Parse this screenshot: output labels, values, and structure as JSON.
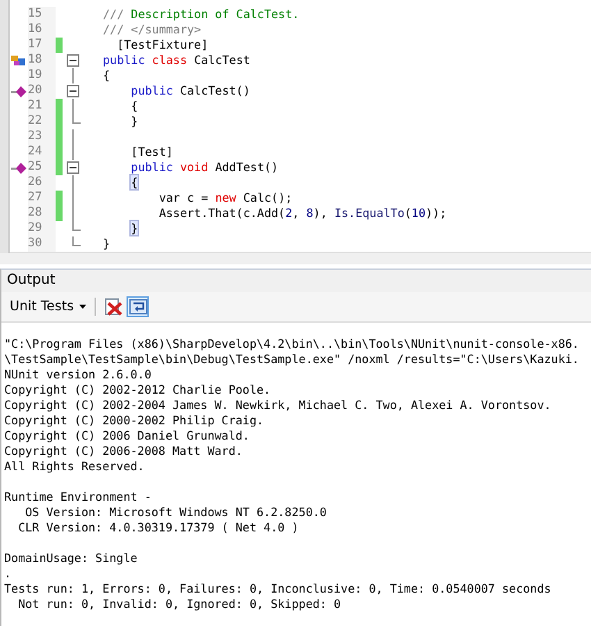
{
  "editor": {
    "lines": [
      {
        "number": "15",
        "changed": false,
        "kind": "plain",
        "tokens": [
          {
            "kind": "doc",
            "text": "/// "
          },
          {
            "kind": "comment",
            "text": "Description of CalcTest."
          }
        ]
      },
      {
        "number": "16",
        "changed": false,
        "kind": "plain",
        "tokens": [
          {
            "kind": "doc",
            "text": "/// </summary>"
          }
        ]
      },
      {
        "number": "17",
        "changed": true,
        "kind": "plain",
        "tokens": [
          {
            "kind": "plain",
            "text": "  [TestFixture]"
          }
        ]
      },
      {
        "number": "18",
        "changed": false,
        "kind": "class_start",
        "tokens": [
          {
            "kind": "keyword",
            "text": "public "
          },
          {
            "kind": "keyword2",
            "text": "class "
          },
          {
            "kind": "plain",
            "text": "CalcTest"
          }
        ]
      },
      {
        "number": "19",
        "changed": false,
        "kind": "body",
        "tokens": [
          {
            "kind": "plain",
            "text": "{"
          }
        ]
      },
      {
        "number": "20",
        "changed": false,
        "kind": "method_start",
        "tokens": [
          {
            "kind": "keyword",
            "text": "    public "
          },
          {
            "kind": "plain",
            "text": "CalcTest()"
          }
        ]
      },
      {
        "number": "21",
        "changed": true,
        "kind": "body",
        "tokens": [
          {
            "kind": "plain",
            "text": "    {"
          }
        ]
      },
      {
        "number": "22",
        "changed": true,
        "kind": "block_end",
        "tokens": [
          {
            "kind": "plain",
            "text": "    }"
          }
        ]
      },
      {
        "number": "23",
        "changed": true,
        "kind": "body"
      },
      {
        "number": "24",
        "changed": true,
        "kind": "body",
        "tokens": [
          {
            "kind": "plain",
            "text": "    [Test]"
          }
        ]
      },
      {
        "number": "25",
        "changed": true,
        "kind": "method_start",
        "tokens": [
          {
            "kind": "keyword",
            "text": "    public "
          },
          {
            "kind": "keyword2",
            "text": "void "
          },
          {
            "kind": "plain",
            "text": "AddTest()"
          }
        ]
      },
      {
        "number": "26",
        "changed": false,
        "kind": "body",
        "tokens": [
          {
            "kind": "brace_match",
            "text": "    {"
          }
        ]
      },
      {
        "number": "27",
        "changed": true,
        "kind": "body",
        "tokens": [
          {
            "kind": "plain",
            "text": "        var c = "
          },
          {
            "kind": "keyword2",
            "text": "new "
          },
          {
            "kind": "plain",
            "text": "Calc();"
          }
        ]
      },
      {
        "number": "28",
        "changed": true,
        "kind": "body",
        "tokens": [
          {
            "kind": "plain",
            "text": "        Assert.That(c.Add("
          },
          {
            "kind": "number",
            "text": "2"
          },
          {
            "kind": "plain",
            "text": ", "
          },
          {
            "kind": "number",
            "text": "8"
          },
          {
            "kind": "plain",
            "text": "), "
          },
          {
            "kind": "member",
            "text": "Is.EqualTo"
          },
          {
            "kind": "plain",
            "text": "("
          },
          {
            "kind": "number",
            "text": "10"
          },
          {
            "kind": "plain",
            "text": "));"
          }
        ]
      },
      {
        "number": "29",
        "changed": false,
        "kind": "block_end",
        "tokens": [
          {
            "kind": "brace_match",
            "text": "    }"
          }
        ]
      },
      {
        "number": "30",
        "changed": false,
        "kind": "block_end",
        "tokens": [
          {
            "kind": "plain",
            "text": "}"
          }
        ]
      }
    ]
  },
  "output": {
    "title": "Output",
    "dropdown": "Unit Tests",
    "buttons": [
      {
        "kind": "clear",
        "selected": false
      },
      {
        "kind": "word_wrap",
        "selected": true
      }
    ],
    "blocks": [
      [
        "\"C:\\Program Files (x86)\\SharpDevelop\\4.2\\bin\\..\\bin\\Tools\\NUnit\\nunit-console-x86.",
        "\\TestSample\\TestSample\\bin\\Debug\\TestSample.exe\" /noxml /results=\"C:\\Users\\Kazuki.",
        "NUnit version 2.6.0.0",
        "Copyright (C) 2002-2012 Charlie Poole.",
        "Copyright (C) 2002-2004 James W. Newkirk, Michael C. Two, Alexei A. Vorontsov.",
        "Copyright (C) 2000-2002 Philip Craig.",
        "Copyright (C) 2006 Daniel Grunwald.",
        "Copyright (C) 2006-2008 Matt Ward.",
        "All Rights Reserved."
      ],
      [
        "Runtime Environment -",
        "   OS Version: Microsoft Windows NT 6.2.8250.0",
        "  CLR Version: 4.0.30319.17379 ( Net 4.0 )"
      ],
      [
        "DomainUsage: Single",
        ".",
        "Tests run: 1, Errors: 0, Failures: 0, Inconclusive: 0, Time: 0.0540007 seconds",
        "  Not run: 0, Invalid: 0, Ignored: 0, Skipped: 0"
      ]
    ]
  }
}
